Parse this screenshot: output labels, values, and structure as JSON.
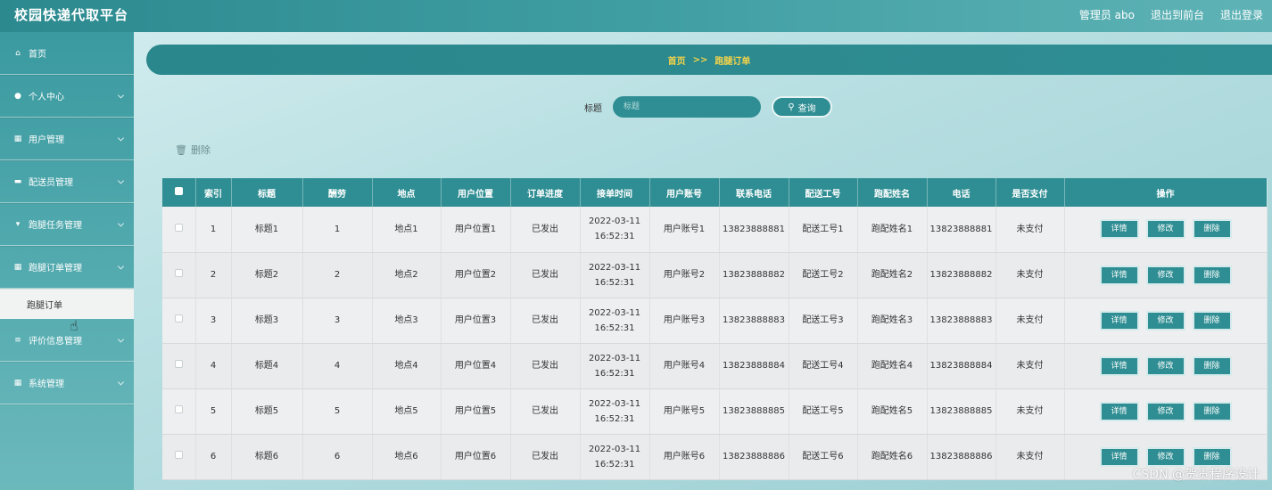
{
  "header": {
    "title": "校园快递代取平台",
    "links": [
      "管理员 abo",
      "退出到前台",
      "退出登录"
    ]
  },
  "sidebar": {
    "items": [
      {
        "label": "首页",
        "icon": "home-icon"
      },
      {
        "label": "个人中心",
        "icon": "user-icon"
      },
      {
        "label": "用户管理",
        "icon": "grid-icon"
      },
      {
        "label": "配送员管理",
        "icon": "briefcase-icon"
      },
      {
        "label": "跑腿任务管理",
        "icon": "task-icon"
      },
      {
        "label": "跑腿订单管理",
        "icon": "grid-icon"
      },
      {
        "label": "评价信息管理",
        "icon": "list-icon"
      },
      {
        "label": "系统管理",
        "icon": "grid-icon"
      }
    ],
    "subitem": "跑腿订单"
  },
  "breadcrumb": {
    "home": "首页",
    "sep": ">>",
    "current": "跑腿订单"
  },
  "search": {
    "label": "标题",
    "placeholder": "标题",
    "button": "查询"
  },
  "toolbar": {
    "delete_label": "删除"
  },
  "table": {
    "headers": [
      "索引",
      "标题",
      "酬劳",
      "地点",
      "用户位置",
      "订单进度",
      "接单时间",
      "用户账号",
      "联系电话",
      "配送工号",
      "跑配姓名",
      "电话",
      "是否支付",
      "操作"
    ],
    "actions": [
      "详情",
      "修改",
      "删除"
    ],
    "rows": [
      [
        "1",
        "标题1",
        "1",
        "地点1",
        "用户位置1",
        "已发出",
        "2022-03-11 16:52:31",
        "用户账号1",
        "13823888881",
        "配送工号1",
        "跑配姓名1",
        "13823888881",
        "未支付"
      ],
      [
        "2",
        "标题2",
        "2",
        "地点2",
        "用户位置2",
        "已发出",
        "2022-03-11 16:52:31",
        "用户账号2",
        "13823888882",
        "配送工号2",
        "跑配姓名2",
        "13823888882",
        "未支付"
      ],
      [
        "3",
        "标题3",
        "3",
        "地点3",
        "用户位置3",
        "已发出",
        "2022-03-11 16:52:31",
        "用户账号3",
        "13823888883",
        "配送工号3",
        "跑配姓名3",
        "13823888883",
        "未支付"
      ],
      [
        "4",
        "标题4",
        "4",
        "地点4",
        "用户位置4",
        "已发出",
        "2022-03-11 16:52:31",
        "用户账号4",
        "13823888884",
        "配送工号4",
        "跑配姓名4",
        "13823888884",
        "未支付"
      ],
      [
        "5",
        "标题5",
        "5",
        "地点5",
        "用户位置5",
        "已发出",
        "2022-03-11 16:52:31",
        "用户账号5",
        "13823888885",
        "配送工号5",
        "跑配姓名5",
        "13823888885",
        "未支付"
      ],
      [
        "6",
        "标题6",
        "6",
        "地点6",
        "用户位置6",
        "已发出",
        "2022-03-11 16:52:31",
        "用户账号6",
        "13823888886",
        "配送工号6",
        "跑配姓名6",
        "13823888886",
        "未支付"
      ]
    ]
  },
  "watermark": "CSDN @贺贵程序设计",
  "colors": {
    "primary": "#2f8e93",
    "breadcrumb_text": "#f3d34a"
  }
}
